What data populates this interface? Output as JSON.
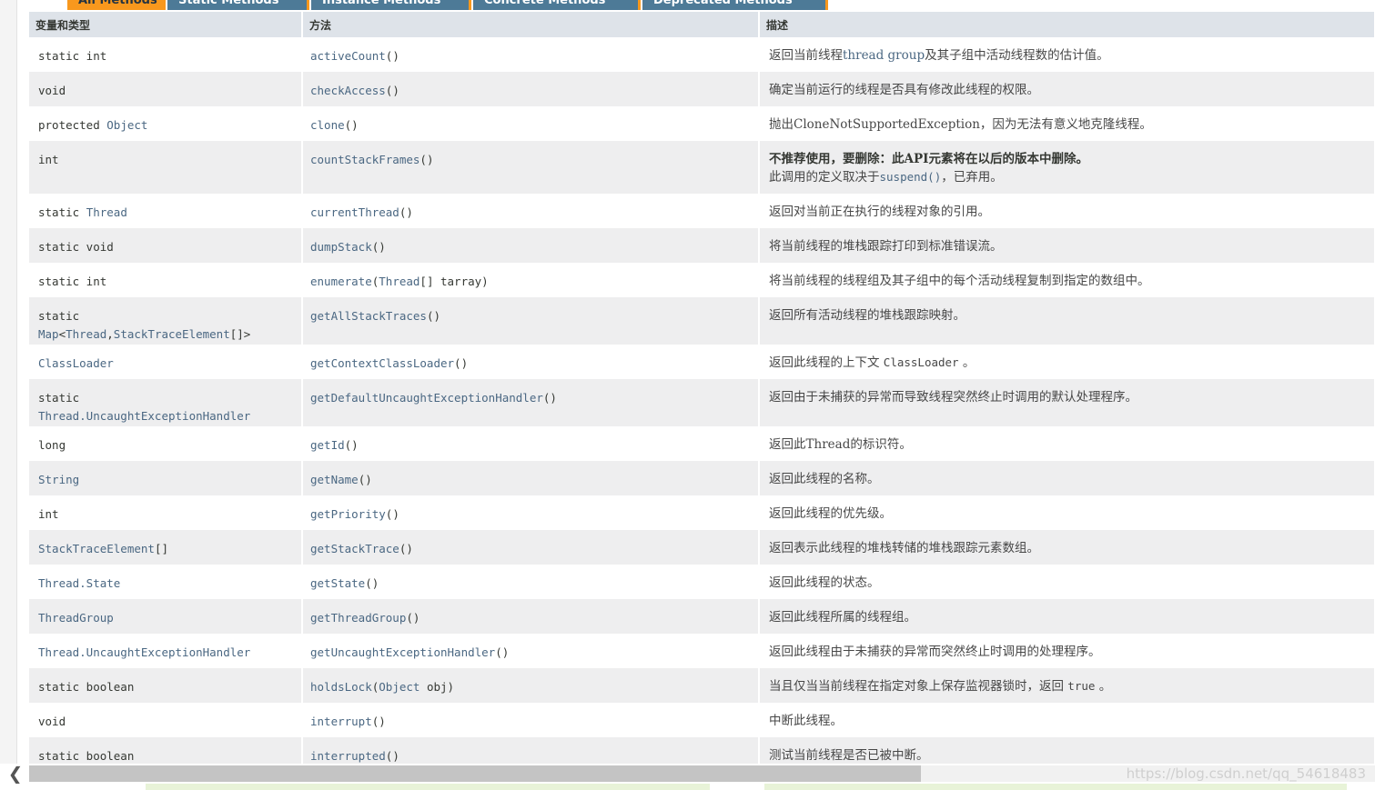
{
  "tabs": [
    {
      "label": "All Methods",
      "active": true
    },
    {
      "label": "Static Methods",
      "active": false
    },
    {
      "label": "Instance Methods",
      "active": false
    },
    {
      "label": "Concrete Methods",
      "active": false
    },
    {
      "label": "Deprecated Methods",
      "active": false
    }
  ],
  "table": {
    "headers": {
      "type": "变量和类型",
      "method": "方法",
      "desc": "描述"
    },
    "rows": [
      {
        "type": [
          {
            "t": "static int"
          }
        ],
        "method": [
          {
            "t": "activeCount",
            "link": true
          },
          {
            "t": "()"
          }
        ],
        "desc": [
          {
            "t": "返回当前线程"
          },
          {
            "t": "thread group",
            "link": true
          },
          {
            "t": "及其子组中活动线程数的估计值。"
          }
        ]
      },
      {
        "type": [
          {
            "t": "void"
          }
        ],
        "method": [
          {
            "t": "checkAccess",
            "link": true
          },
          {
            "t": "()"
          }
        ],
        "desc": [
          {
            "t": "确定当前运行的线程是否具有修改此线程的权限。"
          }
        ]
      },
      {
        "type": [
          {
            "t": "protected "
          },
          {
            "t": "Object",
            "link": true
          }
        ],
        "method": [
          {
            "t": "clone",
            "link": true
          },
          {
            "t": "()"
          }
        ],
        "desc": [
          {
            "t": "抛出CloneNotSupportedException，因为无法有意义地克隆线程。"
          }
        ]
      },
      {
        "type": [
          {
            "t": "int"
          }
        ],
        "method": [
          {
            "t": "countStackFrames",
            "link": true
          },
          {
            "t": "()"
          }
        ],
        "desc": [
          {
            "t": "不推荐使用，要删除：此API元素将在以后的版本中删除。",
            "strong": true
          },
          {
            "br": true
          },
          {
            "t": "此调用的定义取决于"
          },
          {
            "t": "suspend()",
            "link": true,
            "mono": true
          },
          {
            "t": "，已弃用。"
          }
        ]
      },
      {
        "type": [
          {
            "t": "static "
          },
          {
            "t": "Thread",
            "link": true
          }
        ],
        "method": [
          {
            "t": "currentThread",
            "link": true
          },
          {
            "t": "()"
          }
        ],
        "desc": [
          {
            "t": "返回对当前正在执行的线程对象的引用。"
          }
        ]
      },
      {
        "type": [
          {
            "t": "static void"
          }
        ],
        "method": [
          {
            "t": "dumpStack",
            "link": true
          },
          {
            "t": "()"
          }
        ],
        "desc": [
          {
            "t": "将当前线程的堆栈跟踪打印到标准错误流。"
          }
        ]
      },
      {
        "type": [
          {
            "t": "static int"
          }
        ],
        "method": [
          {
            "t": "enumerate",
            "link": true
          },
          {
            "t": "("
          },
          {
            "t": "Thread",
            "link": true
          },
          {
            "t": "[] tarray)"
          }
        ],
        "desc": [
          {
            "t": "将当前线程的线程组及其子组中的每个活动线程复制到指定的数组中。"
          }
        ]
      },
      {
        "type": [
          {
            "t": "static "
          },
          {
            "t": "Map",
            "link": true
          },
          {
            "t": "<"
          },
          {
            "t": "Thread",
            "link": true
          },
          {
            "t": ","
          },
          {
            "t": "StackTraceElement",
            "link": true
          },
          {
            "t": "[]>"
          }
        ],
        "method": [
          {
            "t": "getAllStackTraces",
            "link": true
          },
          {
            "t": "()"
          }
        ],
        "desc": [
          {
            "t": "返回所有活动线程的堆栈跟踪映射。"
          }
        ]
      },
      {
        "type": [
          {
            "t": "ClassLoader",
            "link": true
          }
        ],
        "method": [
          {
            "t": "getContextClassLoader",
            "link": true
          },
          {
            "t": "()"
          }
        ],
        "desc": [
          {
            "t": "返回此线程的上下文 "
          },
          {
            "t": "ClassLoader",
            "mono": true
          },
          {
            "t": " 。"
          }
        ]
      },
      {
        "type": [
          {
            "t": "static "
          },
          {
            "br": true
          },
          {
            "t": "Thread.UncaughtExceptionHandler",
            "link": true
          }
        ],
        "method": [
          {
            "t": "getDefaultUncaughtExceptionHandler",
            "link": true
          },
          {
            "t": "()"
          }
        ],
        "desc": [
          {
            "t": "返回由于未捕获的异常而导致线程突然终止时调用的默认处理程序。"
          }
        ]
      },
      {
        "type": [
          {
            "t": "long"
          }
        ],
        "method": [
          {
            "t": "getId",
            "link": true
          },
          {
            "t": "()"
          }
        ],
        "desc": [
          {
            "t": "返回此Thread的标识符。"
          }
        ]
      },
      {
        "type": [
          {
            "t": "String",
            "link": true
          }
        ],
        "method": [
          {
            "t": "getName",
            "link": true
          },
          {
            "t": "()"
          }
        ],
        "desc": [
          {
            "t": "返回此线程的名称。"
          }
        ]
      },
      {
        "type": [
          {
            "t": "int"
          }
        ],
        "method": [
          {
            "t": "getPriority",
            "link": true
          },
          {
            "t": "()"
          }
        ],
        "desc": [
          {
            "t": "返回此线程的优先级。"
          }
        ]
      },
      {
        "type": [
          {
            "t": "StackTraceElement",
            "link": true
          },
          {
            "t": "[]"
          }
        ],
        "method": [
          {
            "t": "getStackTrace",
            "link": true
          },
          {
            "t": "()"
          }
        ],
        "desc": [
          {
            "t": "返回表示此线程的堆栈转储的堆栈跟踪元素数组。"
          }
        ]
      },
      {
        "type": [
          {
            "t": "Thread.State",
            "link": true
          }
        ],
        "method": [
          {
            "t": "getState",
            "link": true
          },
          {
            "t": "()"
          }
        ],
        "desc": [
          {
            "t": "返回此线程的状态。"
          }
        ]
      },
      {
        "type": [
          {
            "t": "ThreadGroup",
            "link": true
          }
        ],
        "method": [
          {
            "t": "getThreadGroup",
            "link": true
          },
          {
            "t": "()"
          }
        ],
        "desc": [
          {
            "t": "返回此线程所属的线程组。"
          }
        ]
      },
      {
        "type": [
          {
            "t": "Thread.UncaughtExceptionHandler",
            "link": true
          }
        ],
        "method": [
          {
            "t": "getUncaughtExceptionHandler",
            "link": true
          },
          {
            "t": "()"
          }
        ],
        "desc": [
          {
            "t": "返回此线程由于未捕获的异常而突然终止时调用的处理程序。"
          }
        ]
      },
      {
        "type": [
          {
            "t": "static boolean"
          }
        ],
        "method": [
          {
            "t": "holdsLock",
            "link": true
          },
          {
            "t": "("
          },
          {
            "t": "Object",
            "link": true
          },
          {
            "t": " obj)"
          }
        ],
        "desc": [
          {
            "t": "当且仅当当前线程在指定对象上保存监视器锁时，返回 "
          },
          {
            "t": "true",
            "mono": true
          },
          {
            "t": " 。"
          }
        ]
      },
      {
        "type": [
          {
            "t": "void"
          }
        ],
        "method": [
          {
            "t": "interrupt",
            "link": true
          },
          {
            "t": "()"
          }
        ],
        "desc": [
          {
            "t": "中断此线程。"
          }
        ]
      },
      {
        "type": [
          {
            "t": "static boolean"
          }
        ],
        "method": [
          {
            "t": "interrupted",
            "link": true
          },
          {
            "t": "()"
          }
        ],
        "desc": [
          {
            "t": "测试当前线程是否已被中断。"
          }
        ]
      }
    ]
  },
  "watermark": "https://blog.csdn.net/qq_54618483",
  "scroll": {
    "left_arrow_glyph": "❮"
  },
  "colors": {
    "header_bg": "#dee3e9",
    "tab_bg": "#4d7a97",
    "tab_active": "#f8981d",
    "link": "#4a6782",
    "row_alt": "#eeeeef"
  }
}
